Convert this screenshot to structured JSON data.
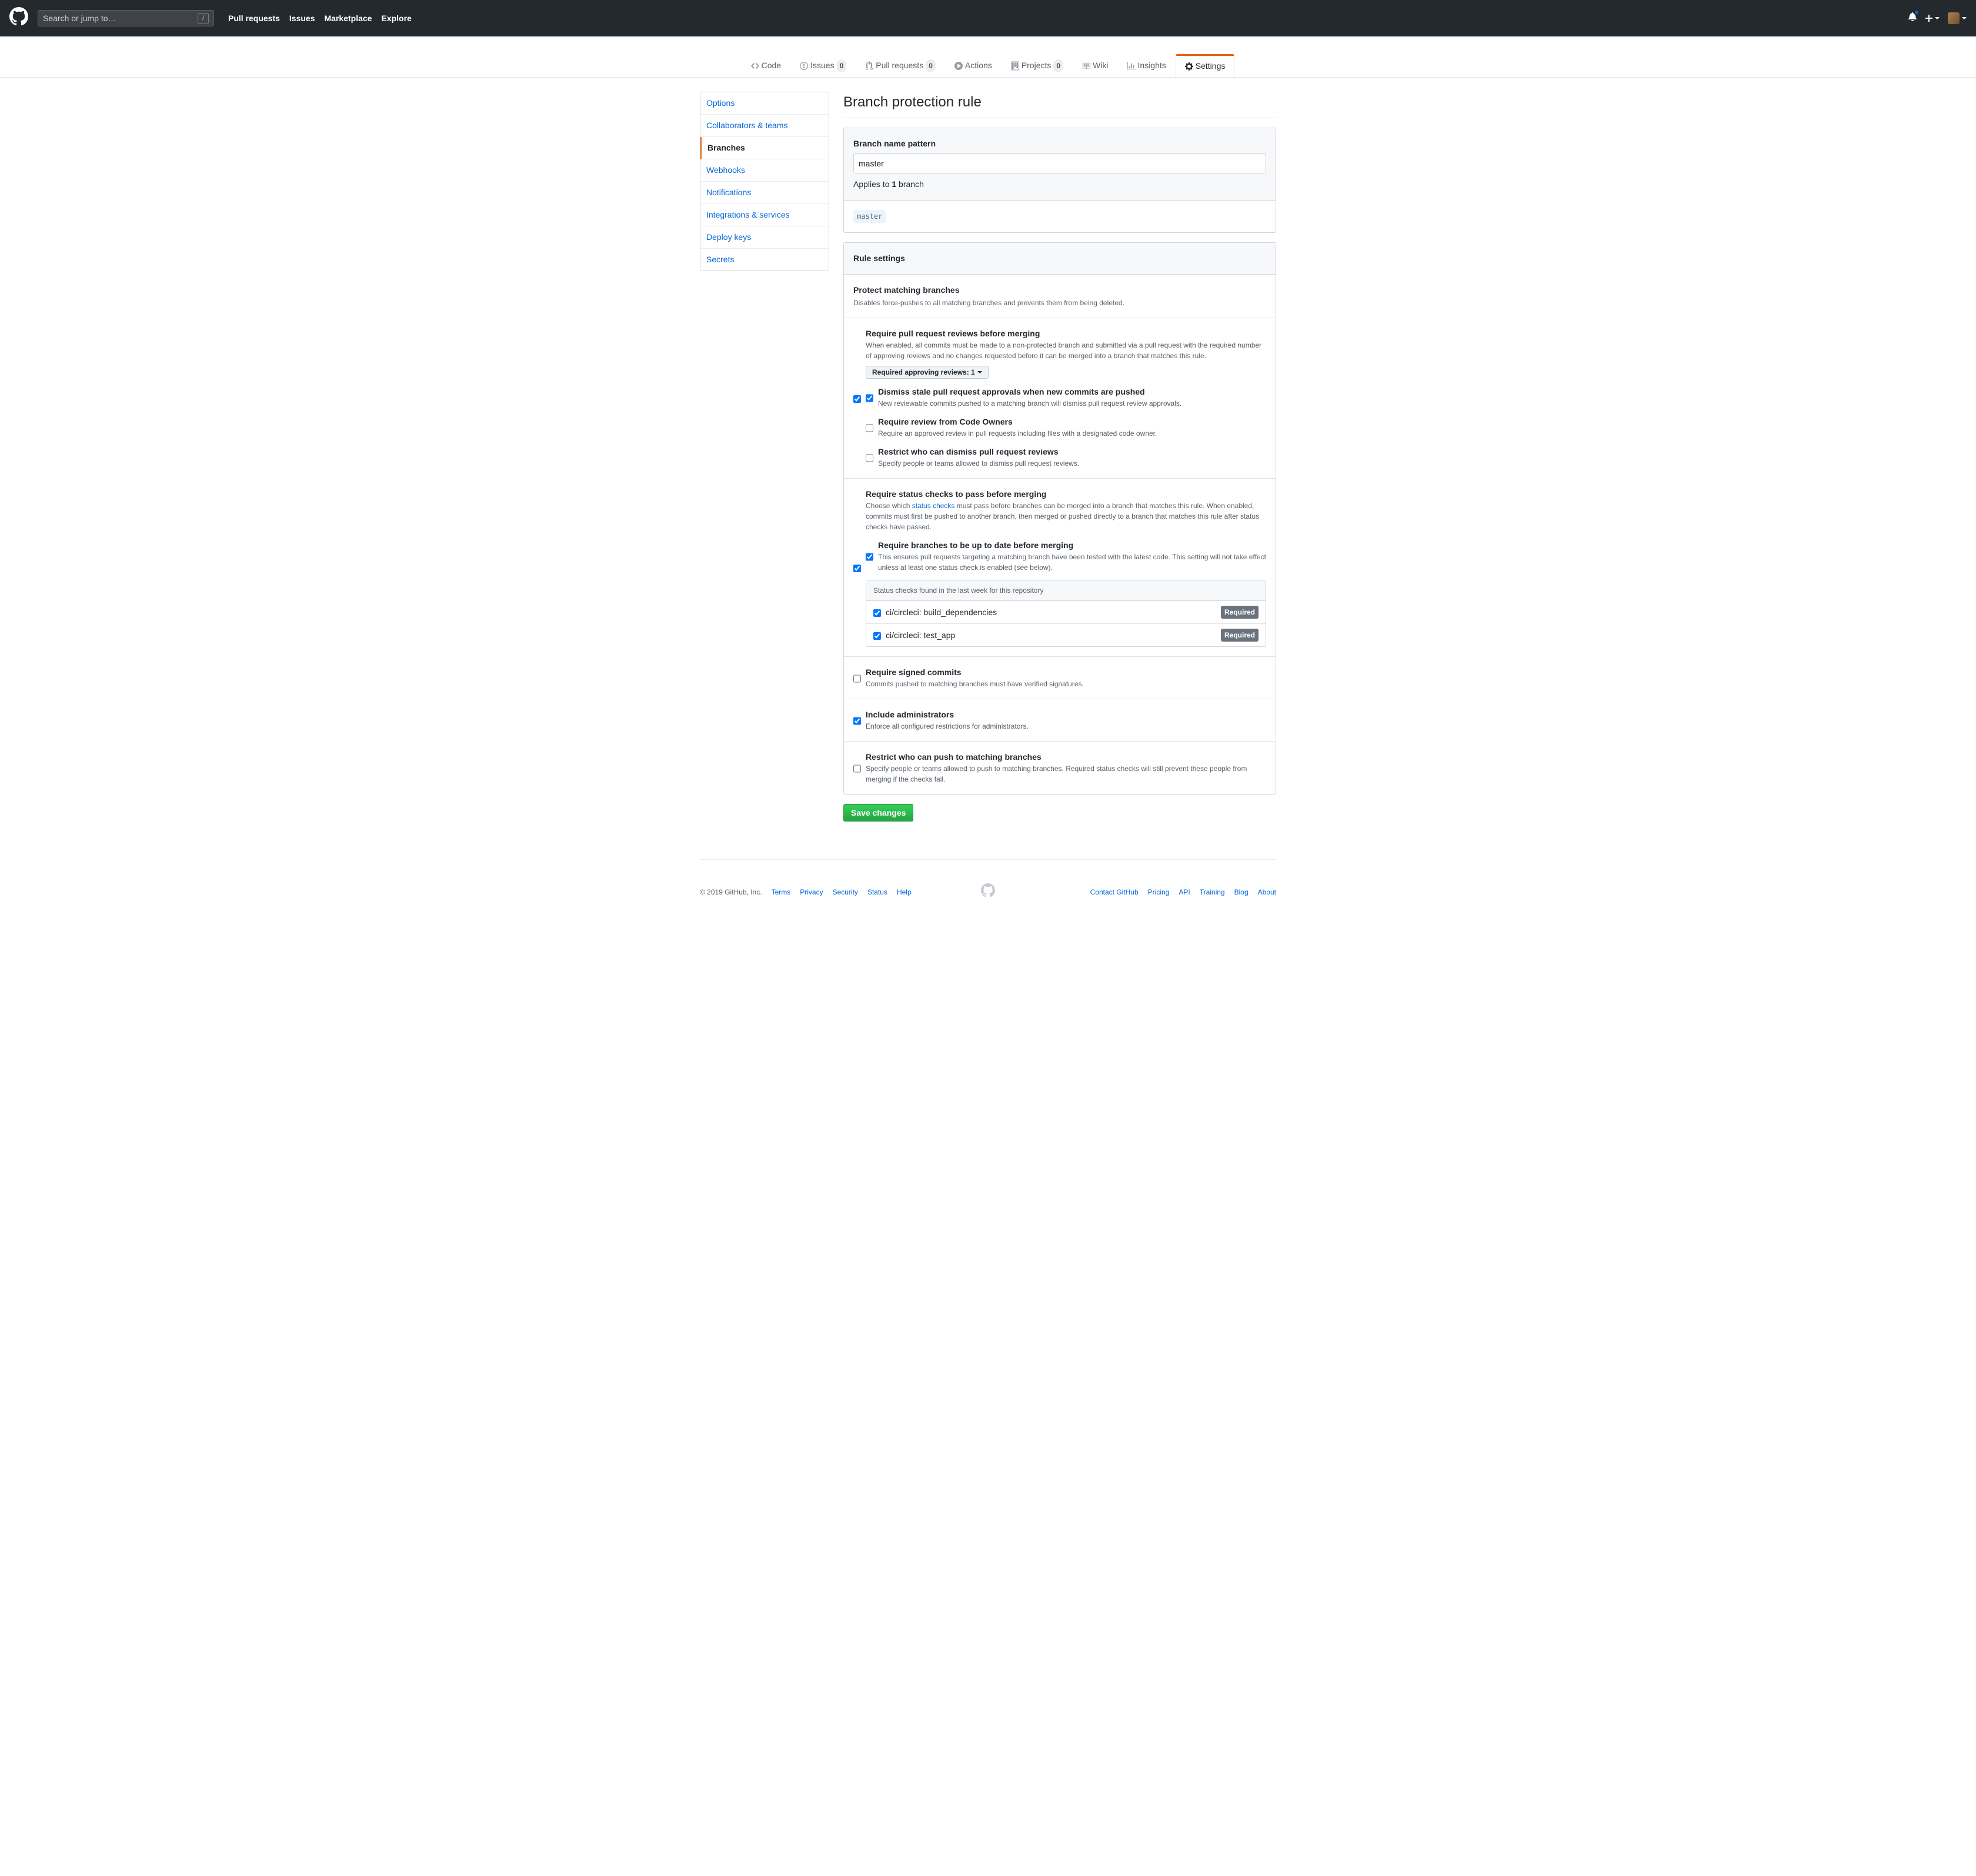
{
  "header": {
    "search_placeholder": "Search or jump to…",
    "nav": [
      "Pull requests",
      "Issues",
      "Marketplace",
      "Explore"
    ]
  },
  "reponav": {
    "code": "Code",
    "issues": "Issues",
    "issues_count": "0",
    "pulls": "Pull requests",
    "pulls_count": "0",
    "actions": "Actions",
    "projects": "Projects",
    "projects_count": "0",
    "wiki": "Wiki",
    "insights": "Insights",
    "settings": "Settings"
  },
  "sidebar": {
    "items": [
      {
        "label": "Options"
      },
      {
        "label": "Collaborators & teams"
      },
      {
        "label": "Branches"
      },
      {
        "label": "Webhooks"
      },
      {
        "label": "Notifications"
      },
      {
        "label": "Integrations & services"
      },
      {
        "label": "Deploy keys"
      },
      {
        "label": "Secrets"
      }
    ]
  },
  "page": {
    "title": "Branch protection rule",
    "branch_pattern_label": "Branch name pattern",
    "branch_pattern_value": "master",
    "applies_prefix": "Applies to ",
    "applies_count": "1",
    "applies_suffix": " branch",
    "matched_branch": "master",
    "rule_settings_title": "Rule settings",
    "protect_title": "Protect matching branches",
    "protect_desc": "Disables force-pushes to all matching branches and prevents them from being deleted.",
    "require_pr_reviews": {
      "label": "Require pull request reviews before merging",
      "desc": "When enabled, all commits must be made to a non-protected branch and submitted via a pull request with the required number of approving reviews and no changes requested before it can be merged into a branch that matches this rule.",
      "dropdown": "Required approving reviews: 1"
    },
    "dismiss_stale": {
      "label": "Dismiss stale pull request approvals when new commits are pushed",
      "desc": "New reviewable commits pushed to a matching branch will dismiss pull request review approvals."
    },
    "code_owners": {
      "label": "Require review from Code Owners",
      "desc": "Require an approved review in pull requests including files with a designated code owner."
    },
    "restrict_dismiss": {
      "label": "Restrict who can dismiss pull request reviews",
      "desc": "Specify people or teams allowed to dismiss pull request reviews."
    },
    "require_status": {
      "label": "Require status checks to pass before merging",
      "desc_prefix": "Choose which ",
      "desc_link": "status checks",
      "desc_suffix": " must pass before branches can be merged into a branch that matches this rule. When enabled, commits must first be pushed to another branch, then merged or pushed directly to a branch that matches this rule after status checks have passed."
    },
    "require_uptodate": {
      "label": "Require branches to be up to date before merging",
      "desc": "This ensures pull requests targeting a matching branch have been tested with the latest code. This setting will not take effect unless at least one status check is enabled (see below)."
    },
    "status_checks_header": "Status checks found in the last week for this repository",
    "status_checks": [
      {
        "name": "ci/circleci: build_dependencies",
        "required": "Required"
      },
      {
        "name": "ci/circleci: test_app",
        "required": "Required"
      }
    ],
    "signed_commits": {
      "label": "Require signed commits",
      "desc": "Commits pushed to matching branches must have verified signatures."
    },
    "include_admins": {
      "label": "Include administrators",
      "desc": "Enforce all configured restrictions for administrators."
    },
    "restrict_push": {
      "label": "Restrict who can push to matching branches",
      "desc": "Specify people or teams allowed to push to matching branches. Required status checks will still prevent these people from merging if the checks fail."
    },
    "save_button": "Save changes"
  },
  "footer": {
    "copyright": "© 2019 GitHub, Inc.",
    "left": [
      "Terms",
      "Privacy",
      "Security",
      "Status",
      "Help"
    ],
    "right": [
      "Contact GitHub",
      "Pricing",
      "API",
      "Training",
      "Blog",
      "About"
    ]
  }
}
